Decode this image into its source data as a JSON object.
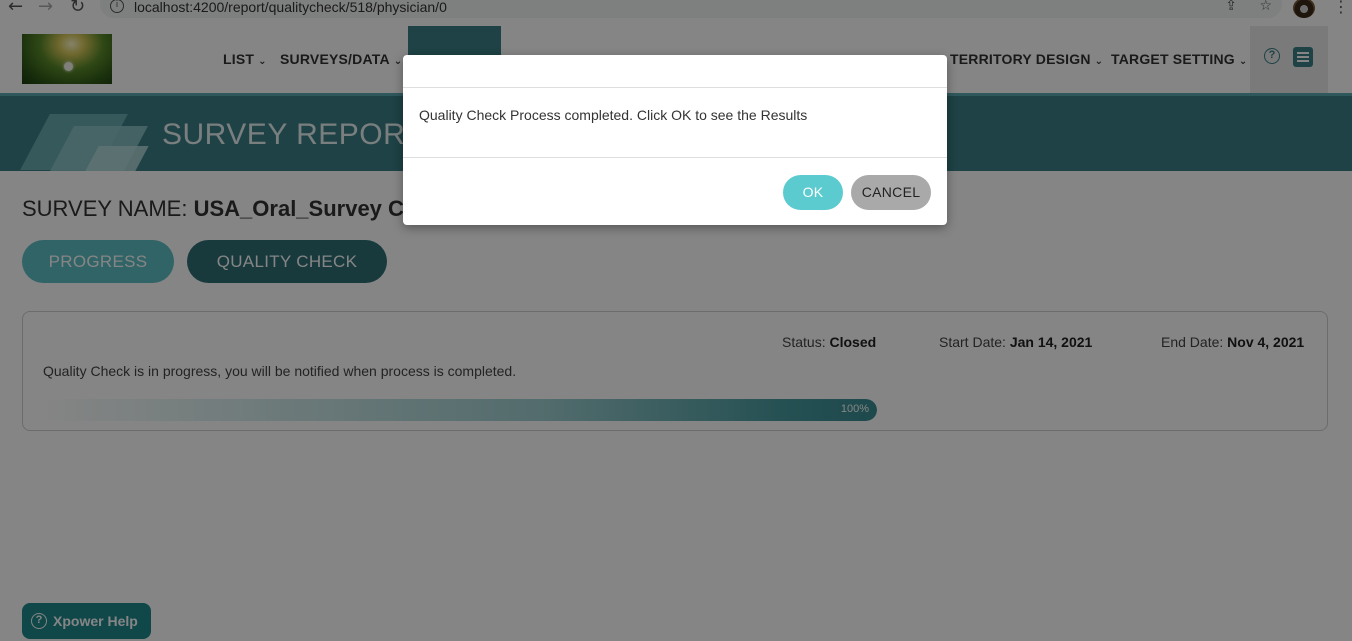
{
  "browser": {
    "url": "localhost:4200/report/qualitycheck/518/physician/0",
    "back_icon": "←",
    "forward_icon": "→",
    "reload_icon": "↻",
    "share_icon": "⇪",
    "star_icon": "☆",
    "menu_icon": "⋮"
  },
  "header": {
    "menu": [
      {
        "label": "LIST"
      },
      {
        "label": "SURVEYS/DATA"
      },
      {
        "label": "TERRITORY DESIGN"
      },
      {
        "label": "TARGET SETTING"
      }
    ],
    "chevron": "⌄",
    "help_glyph": "?",
    "accent_color": "#3a7f85"
  },
  "banner": {
    "title": "SURVEY REPORT"
  },
  "survey": {
    "label": "SURVEY NAME:",
    "name": "USA_Oral_Survey C"
  },
  "tabs": {
    "progress": "PROGRESS",
    "quality_check": "QUALITY CHECK"
  },
  "status_card": {
    "status_label": "Status:",
    "status_value": "Closed",
    "start_label": "Start Date:",
    "start_value": "Jan 14, 2021",
    "end_label": "End Date:",
    "end_value": "Nov 4, 2021",
    "message": "Quality Check is in progress, you will be notified when process is completed.",
    "progress_percent": 100,
    "progress_label": "100%"
  },
  "help_button": {
    "label": "Xpower Help",
    "glyph": "?"
  },
  "modal": {
    "message": "Quality Check Process completed. Click OK to see the Results",
    "ok_label": "OK",
    "cancel_label": "CANCEL"
  }
}
